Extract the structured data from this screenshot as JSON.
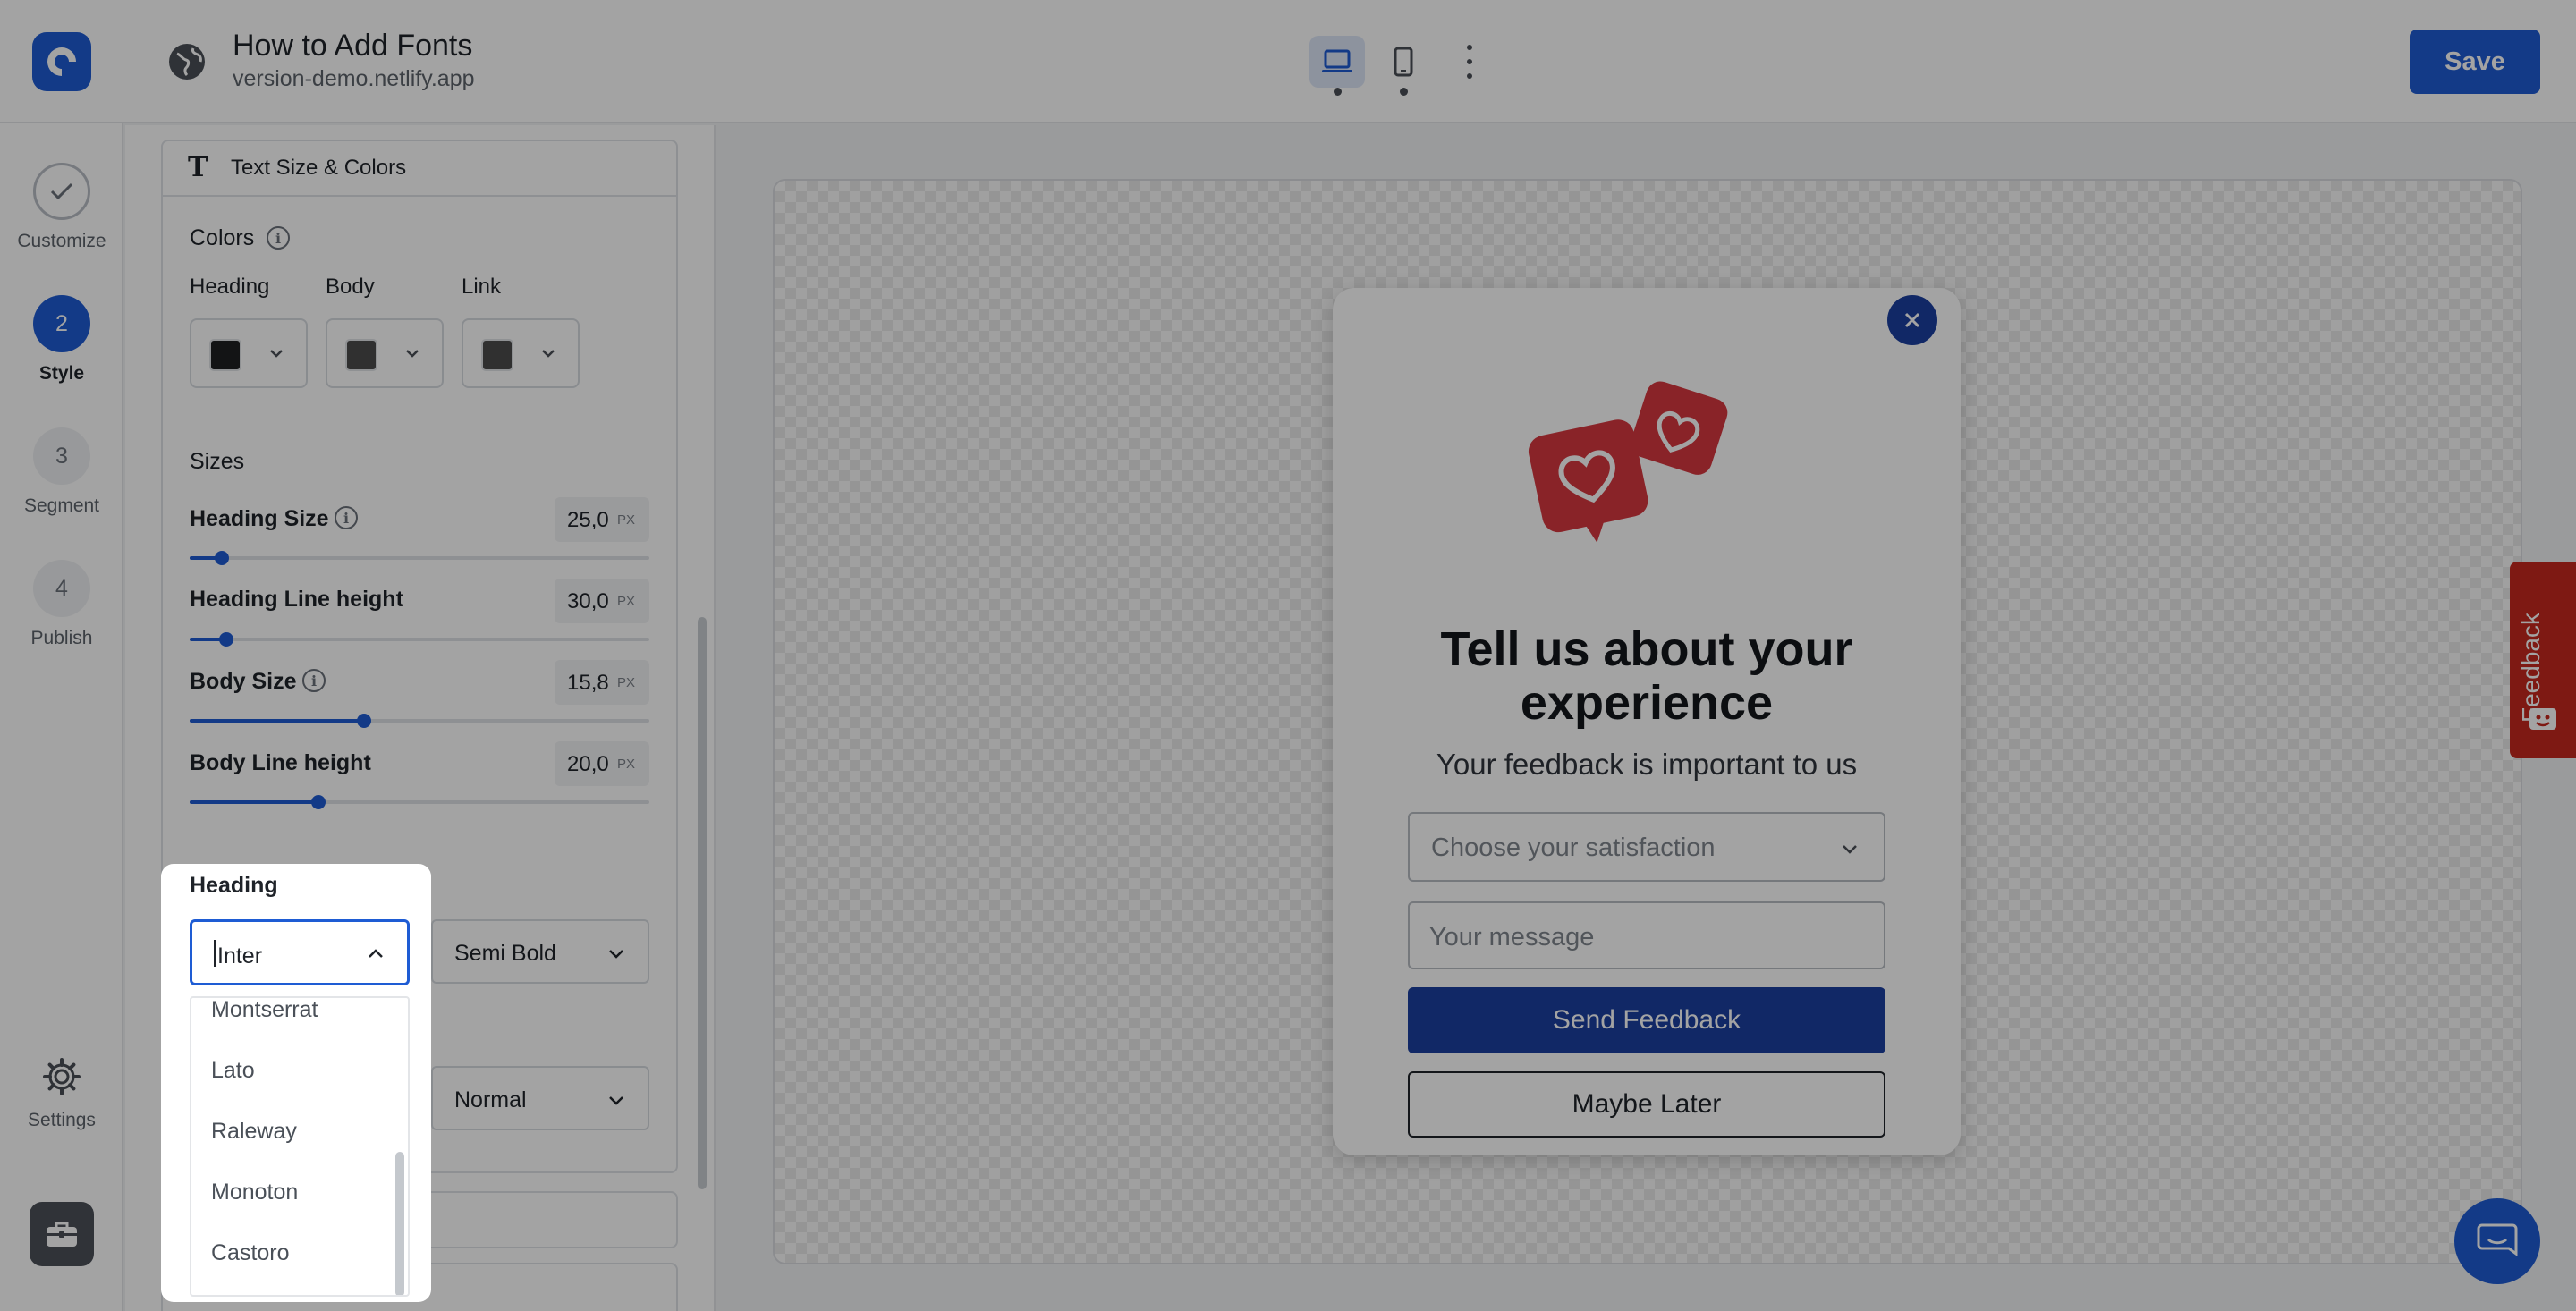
{
  "topbar": {
    "title": "How to Add Fonts",
    "url": "version-demo.netlify.app",
    "save_label": "Save",
    "devices": [
      "laptop-icon",
      "mobile-icon"
    ]
  },
  "rail": {
    "steps": [
      {
        "number": "",
        "label": "Customize",
        "state": "done"
      },
      {
        "number": "2",
        "label": "Style",
        "state": "current"
      },
      {
        "number": "3",
        "label": "Segment",
        "state": "todo"
      },
      {
        "number": "4",
        "label": "Publish",
        "state": "todo"
      }
    ],
    "settings_label": "Settings"
  },
  "panel": {
    "section_title": "Text Size & Colors",
    "colors_label": "Colors",
    "color_pickers": [
      {
        "label": "Heading",
        "color": "#1f2022"
      },
      {
        "label": "Body",
        "color": "#4b4b4b"
      },
      {
        "label": "Link",
        "color": "#4b4b4b"
      }
    ],
    "sizes_label": "Sizes",
    "sliders": [
      {
        "label": "Heading Size",
        "value": "25,0",
        "unit": "PX",
        "fraction": 0.07
      },
      {
        "label": "Heading Line height",
        "value": "30,0",
        "unit": "PX",
        "fraction": 0.08
      },
      {
        "label": "Body Size",
        "value": "15,8",
        "unit": "PX",
        "fraction": 0.38
      },
      {
        "label": "Body Line height",
        "value": "20,0",
        "unit": "PX",
        "fraction": 0.28
      }
    ],
    "heading_weight": "Semi Bold",
    "body_weight": "Normal"
  },
  "font_dropdown": {
    "label": "Heading",
    "input_value": "Inter",
    "options": [
      "Montserrat",
      "Lato",
      "Raleway",
      "Monoton",
      "Castoro"
    ]
  },
  "popup": {
    "title": "Tell us about your experience",
    "subtitle": "Your feedback is important to us",
    "select_placeholder": "Choose your satisfaction",
    "message_placeholder": "Your message",
    "primary_button": "Send Feedback",
    "secondary_button": "Maybe Later"
  },
  "feedback_tab": {
    "label": "Feedback"
  },
  "colors": {
    "accent": "#1e5cd4",
    "popup_accent": "#1c3fa0",
    "feedback_tab": "#c6281e"
  }
}
